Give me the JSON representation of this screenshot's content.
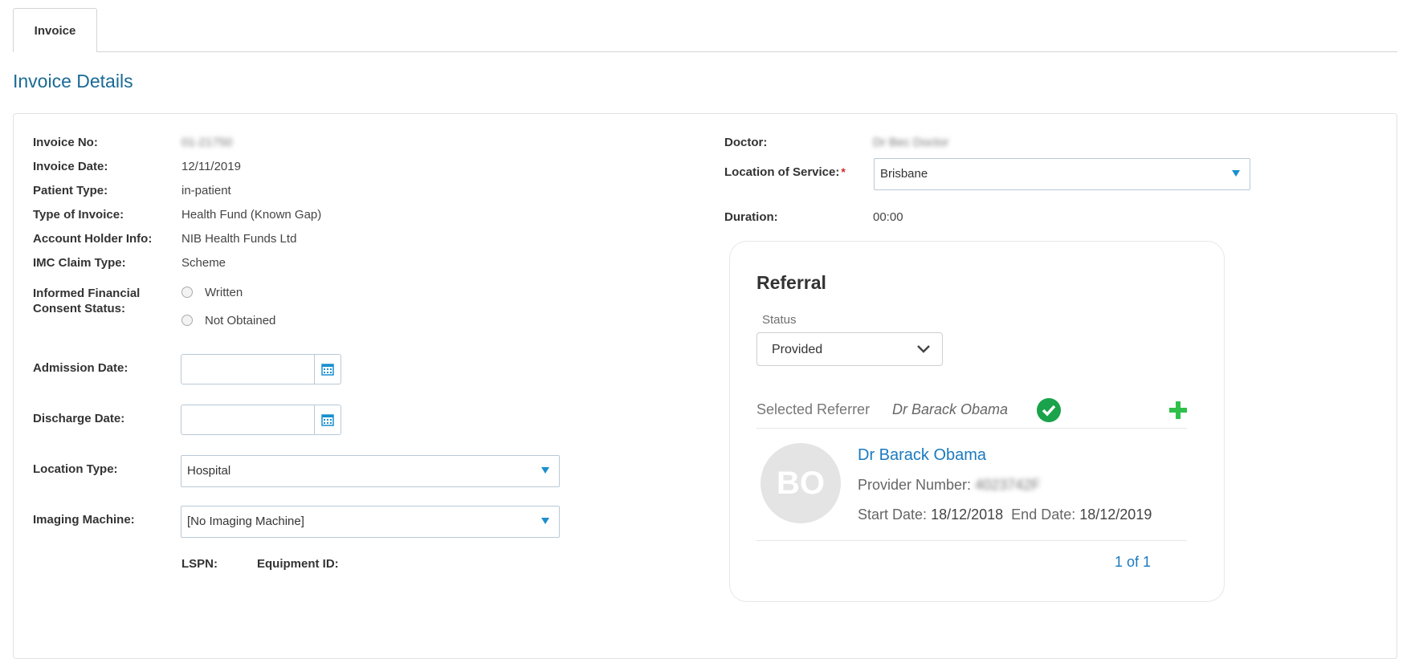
{
  "tabs": [
    {
      "label": "Invoice"
    }
  ],
  "page_title": "Invoice Details",
  "left": {
    "invoice_no": {
      "label": "Invoice No:",
      "value": "01-21750"
    },
    "invoice_date": {
      "label": "Invoice Date:",
      "value": "12/11/2019"
    },
    "patient_type": {
      "label": "Patient Type:",
      "value": "in-patient"
    },
    "type_of_invoice": {
      "label": "Type of Invoice:",
      "value": "Health Fund (Known Gap)"
    },
    "account_holder": {
      "label": "Account Holder Info:",
      "value": "NIB Health Funds Ltd"
    },
    "imc_claim_type": {
      "label": "IMC Claim Type:",
      "value": "Scheme"
    },
    "consent": {
      "label_line1": "Informed Financial",
      "label_line2": "Consent Status:",
      "options": [
        "Written",
        "Not Obtained"
      ]
    },
    "admission_date": {
      "label": "Admission Date:",
      "value": ""
    },
    "discharge_date": {
      "label": "Discharge Date:",
      "value": ""
    },
    "location_type": {
      "label": "Location Type:",
      "value": "Hospital"
    },
    "imaging_machine": {
      "label": "Imaging Machine:",
      "value": "[No Imaging Machine]"
    },
    "lspn_label": "LSPN:",
    "equipment_label": "Equipment ID:"
  },
  "right": {
    "doctor": {
      "label": "Doctor:",
      "value": "Dr Bec Doctor"
    },
    "location_of_service": {
      "label": "Location of Service:",
      "required": "*",
      "value": "Brisbane"
    },
    "duration": {
      "label": "Duration:",
      "value": "00:00"
    }
  },
  "referral": {
    "title": "Referral",
    "status_label": "Status",
    "status_value": "Provided",
    "selected_label": "Selected Referrer",
    "selected_name": "Dr Barack Obama",
    "referrer": {
      "initials": "BO",
      "name": "Dr Barack Obama",
      "provider_label": "Provider Number:",
      "provider_value": "4023742F",
      "start_label": "Start Date:",
      "start_value": "18/12/2018",
      "end_label": "End Date:",
      "end_value": "18/12/2019"
    },
    "pager": "1 of 1"
  },
  "colors": {
    "accent": "#1a6a96",
    "link": "#1a7abf",
    "success": "#1aa34a",
    "add": "#2ec04a",
    "required": "#d9252b"
  },
  "icons": [
    "calendar-icon",
    "dropdown-arrow-icon",
    "chevron-down-icon",
    "check-circle-icon",
    "plus-icon"
  ]
}
